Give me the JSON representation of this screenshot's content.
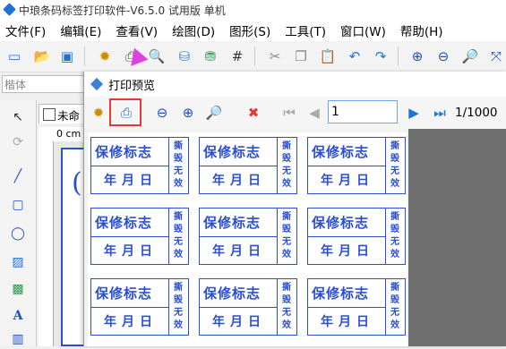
{
  "window": {
    "title": "中琅条码标签打印软件-V6.5.0 试用版 单机"
  },
  "menu": [
    "文件(F)",
    "编辑(E)",
    "查看(V)",
    "绘图(D)",
    "图形(S)",
    "工具(T)",
    "窗口(W)",
    "帮助(H)"
  ],
  "font_combo": {
    "placeholder": "楷体"
  },
  "document_tab": {
    "label": "未命"
  },
  "ruler": {
    "unit": "0 cm"
  },
  "preview_dialog": {
    "title": "打印预览",
    "page_input": "1",
    "page_count": "1/1000"
  },
  "label": {
    "title": "保修标志",
    "date": "年月日",
    "side": [
      "撕",
      "毁",
      "无",
      "效"
    ]
  },
  "colors": {
    "label_blue": "#2a4fd1",
    "highlight_red": "#e53935",
    "arrow_magenta": "#e040e0"
  }
}
